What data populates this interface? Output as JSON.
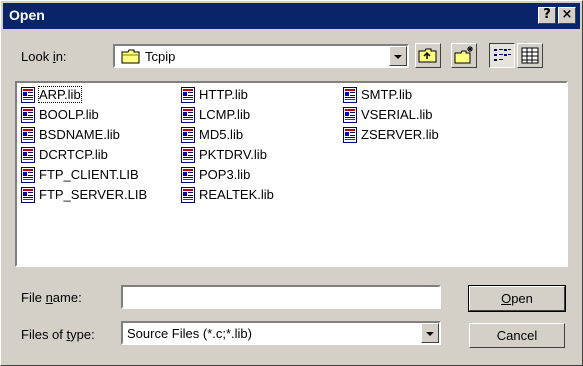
{
  "window": {
    "title": "Open"
  },
  "titlebar_buttons": {
    "help": "?",
    "close": "×"
  },
  "look_in": {
    "label_pre": "Look ",
    "label_accel": "i",
    "label_post": "n:",
    "value": "Tcpip"
  },
  "files": [
    {
      "name": "ARP.lib",
      "selected": true
    },
    {
      "name": "BOOLP.lib"
    },
    {
      "name": "BSDNAME.lib"
    },
    {
      "name": "DCRTCP.lib"
    },
    {
      "name": "FTP_CLIENT.LIB"
    },
    {
      "name": "FTP_SERVER.LIB"
    },
    {
      "name": "HTTP.lib"
    },
    {
      "name": "LCMP.lib"
    },
    {
      "name": "MD5.lib"
    },
    {
      "name": "PKTDRV.lib"
    },
    {
      "name": "POP3.lib"
    },
    {
      "name": "REALTEK.lib"
    },
    {
      "name": "SMTP.lib"
    },
    {
      "name": "VSERIAL.lib"
    },
    {
      "name": "ZSERVER.lib"
    }
  ],
  "file_name": {
    "label_pre": "File ",
    "label_accel": "n",
    "label_post": "ame:",
    "value": ""
  },
  "files_of_type": {
    "label_pre": "Files of ",
    "label_accel": "t",
    "label_post": "ype:",
    "value": "Source Files (*.c;*.lib)"
  },
  "buttons": {
    "open_accel": "O",
    "open_rest": "pen",
    "cancel": "Cancel"
  },
  "icons": {
    "folder": "folder-icon",
    "up": "up-folder-icon",
    "new_folder": "new-folder-icon",
    "list_view": "list-view-icon",
    "details_view": "details-view-icon",
    "file": "lib-file-icon"
  },
  "colors": {
    "titlebar": "#0a246a",
    "face": "#d4d0c8",
    "title_text": "#ffffff"
  }
}
